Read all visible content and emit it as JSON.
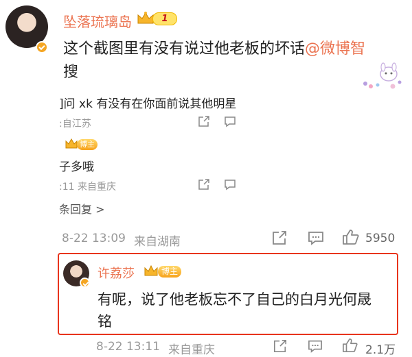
{
  "main_post": {
    "username": "坠落琉璃岛",
    "level_badge": "1",
    "content_line1": "这个截图里有没有说过他老板的坏话",
    "mention": "@微博智",
    "content_line2": "搜"
  },
  "screenshot": {
    "question": "]问 xk 有没有在你面前说其他明星",
    "q_location": ":自江苏",
    "reply_badge": "博主",
    "reply_text": "子多哦",
    "reply_meta": ":11 来自重庆",
    "more_replies": "条回复 >"
  },
  "post_footer": {
    "timestamp": "8-22 13:09",
    "location": "来自湖南",
    "like_count": "5950"
  },
  "reply": {
    "username": "许荔莎",
    "badge": "博主",
    "content_line1": "有呢，说了他老板忘不了自己的白月光何晟",
    "content_line2": "铭",
    "timestamp": "8-22 13:11",
    "location": "来自重庆",
    "like_count": "2.1万"
  },
  "colors": {
    "username": "#eb7350",
    "mention": "#eb7350",
    "highlight_border": "#e8341c",
    "badge_gold": "#f7a21b"
  }
}
